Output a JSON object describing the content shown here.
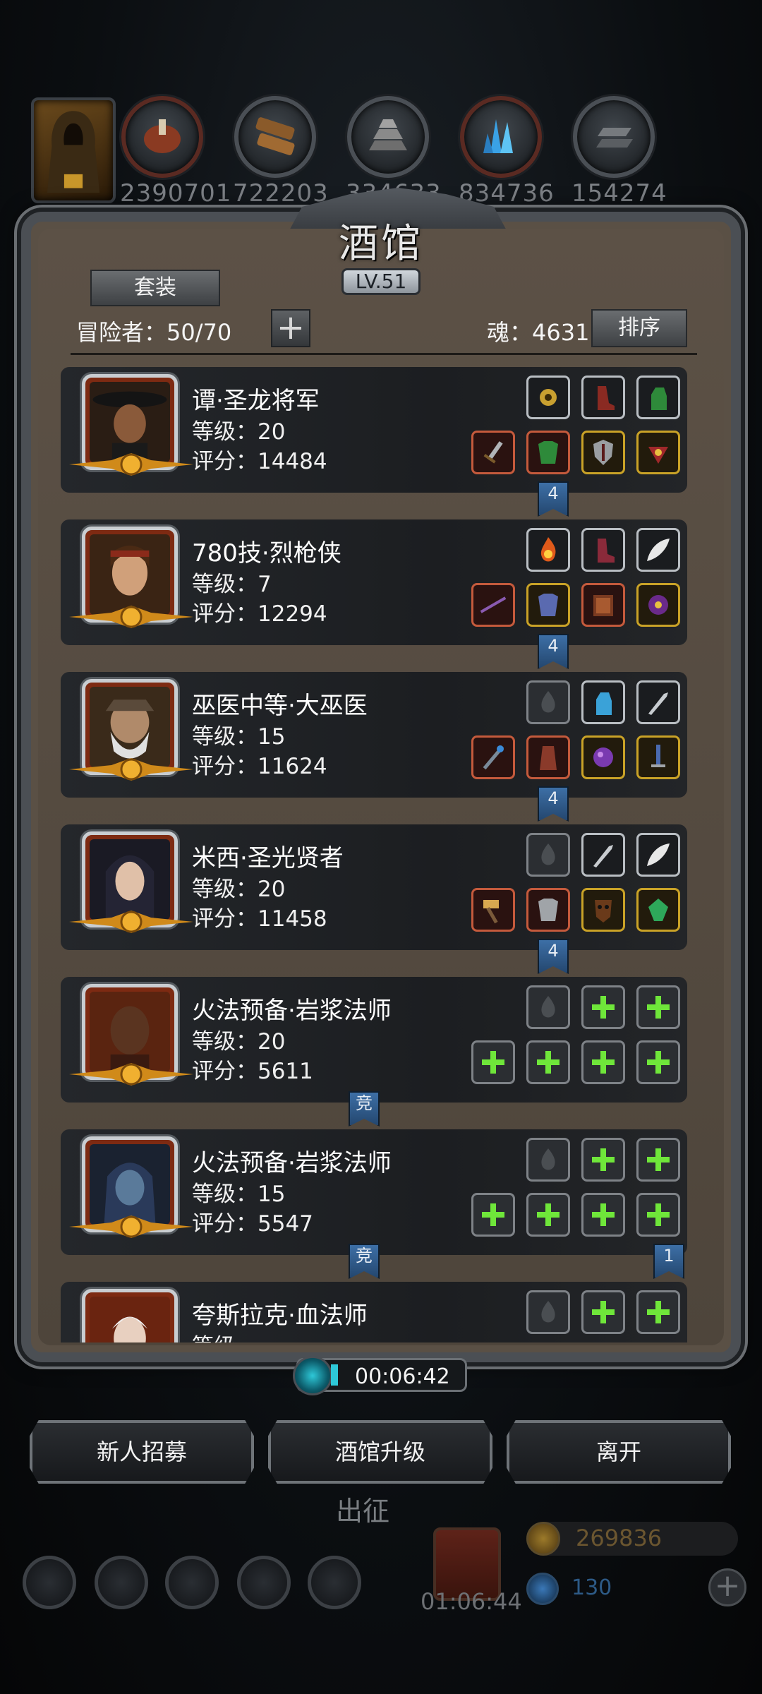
{
  "resources": [
    {
      "icon": "meat-icon",
      "value": "2390701"
    },
    {
      "icon": "wood-icon",
      "value": "722203"
    },
    {
      "icon": "stone-icon",
      "value": "334633"
    },
    {
      "icon": "crystal-icon",
      "value": "834736"
    },
    {
      "icon": "iron-icon",
      "value": "154274"
    }
  ],
  "tavern": {
    "title": "酒馆",
    "level": "LV.51",
    "set_label": "套装",
    "adventurers": "冒险者：50/70",
    "add_symbol": "+",
    "soul": "魂：4631",
    "sort_label": "排序"
  },
  "heroes": [
    {
      "name": "谭·圣龙将军",
      "level": "等级：20",
      "score": "评分：14484",
      "link": "4"
    },
    {
      "name": "780技·烈枪侠",
      "level": "等级：7",
      "score": "评分：12294",
      "link": "4"
    },
    {
      "name": "巫医中等·大巫医",
      "level": "等级：15",
      "score": "评分：11624",
      "link": "4"
    },
    {
      "name": "米西·圣光贤者",
      "level": "等级：20",
      "score": "评分：11458",
      "link": "4"
    },
    {
      "name": "火法预备·岩浆法师",
      "level": "等级：20",
      "score": "评分：5611",
      "link": "竞"
    },
    {
      "name": "火法预备·岩浆法师",
      "level": "等级：15",
      "score": "评分：5547",
      "link": "竞",
      "link2": "1"
    },
    {
      "name": "夸斯拉克·血法师",
      "level": "等级",
      "score": ""
    }
  ],
  "timer": "00:06:42",
  "actions": {
    "recruit": "新人招募",
    "upgrade": "酒馆升级",
    "leave": "离开"
  },
  "faded_label": "出征",
  "footer": {
    "gift_timer": "01:06:44",
    "gold": "269836",
    "gems": "130",
    "add_symbol": "+"
  },
  "colors": {
    "panel": "#5a5045",
    "card": "#1f2124",
    "connector": "#3d6fa6",
    "equip_green": "#6fe63a"
  }
}
